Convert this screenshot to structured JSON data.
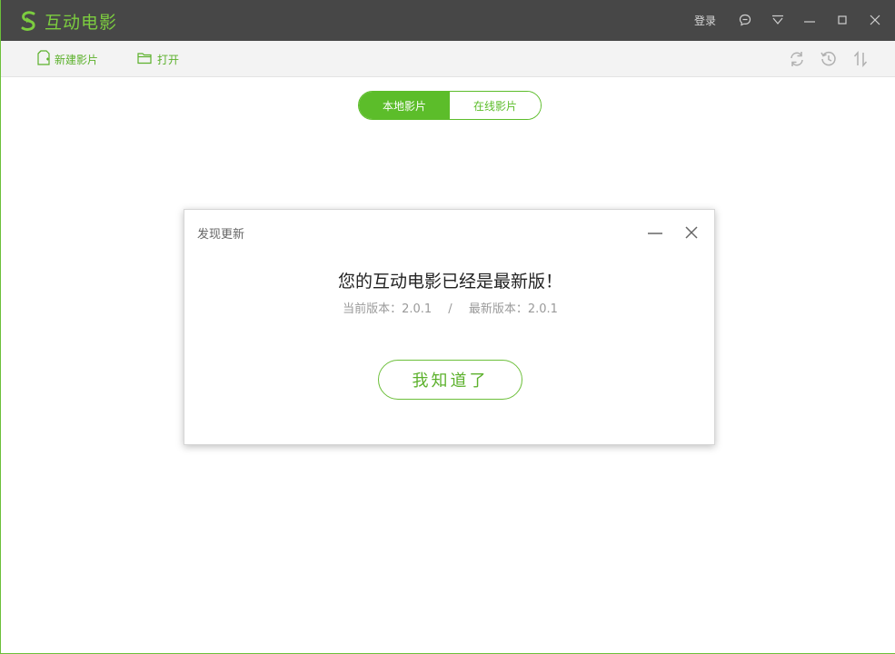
{
  "app": {
    "title": "互动电影",
    "login_label": "登录"
  },
  "titlebar_icons": [
    "chat-icon",
    "dropdown-icon",
    "minimize-icon",
    "maximize-icon",
    "close-icon"
  ],
  "toolbar": {
    "new_label": "新建影片",
    "open_label": "打开",
    "right_icons": [
      "refresh-icon",
      "history-icon",
      "sort-icon"
    ]
  },
  "tabs": [
    {
      "label": "本地影片",
      "active": true
    },
    {
      "label": "在线影片",
      "active": false
    }
  ],
  "dialog": {
    "title": "发现更新",
    "message": "您的互动电影已经是最新版！",
    "current_label": "当前版本：",
    "current_version": "2.0.1",
    "separator": "/",
    "latest_label": "最新版本：",
    "latest_version": "2.0.1",
    "confirm_label": "我知道了"
  },
  "colors": {
    "accent": "#5cbd2a",
    "titlebar": "#474747",
    "toolbar": "#f3f3f3"
  }
}
